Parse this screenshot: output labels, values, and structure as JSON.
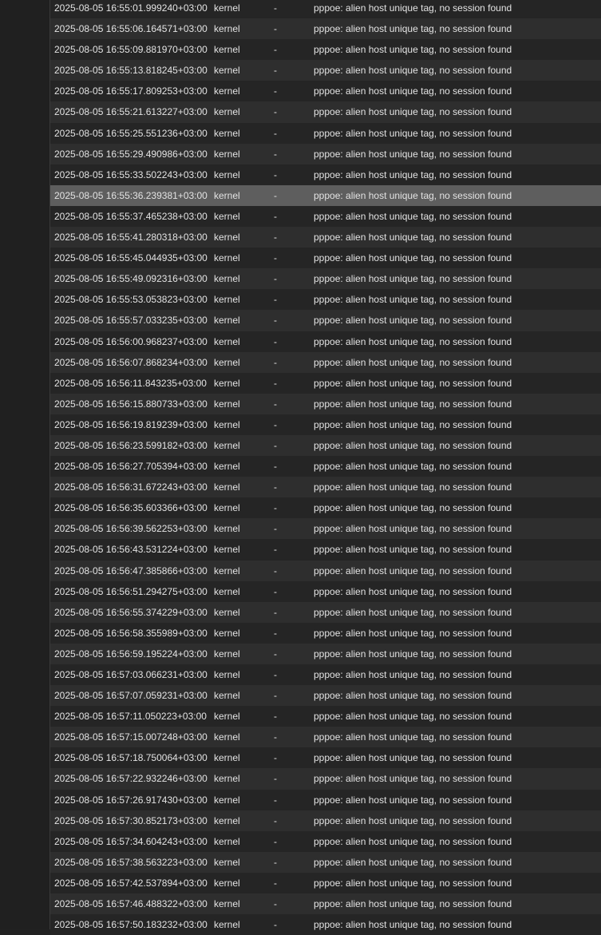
{
  "log": {
    "selected_index": 9,
    "rows": [
      {
        "time": "2025-08-05 16:55:01.999240+03:00",
        "process": "kernel",
        "pid": "-",
        "message": "pppoe: alien host unique tag, no session found"
      },
      {
        "time": "2025-08-05 16:55:06.164571+03:00",
        "process": "kernel",
        "pid": "-",
        "message": "pppoe: alien host unique tag, no session found"
      },
      {
        "time": "2025-08-05 16:55:09.881970+03:00",
        "process": "kernel",
        "pid": "-",
        "message": "pppoe: alien host unique tag, no session found"
      },
      {
        "time": "2025-08-05 16:55:13.818245+03:00",
        "process": "kernel",
        "pid": "-",
        "message": "pppoe: alien host unique tag, no session found"
      },
      {
        "time": "2025-08-05 16:55:17.809253+03:00",
        "process": "kernel",
        "pid": "-",
        "message": "pppoe: alien host unique tag, no session found"
      },
      {
        "time": "2025-08-05 16:55:21.613227+03:00",
        "process": "kernel",
        "pid": "-",
        "message": "pppoe: alien host unique tag, no session found"
      },
      {
        "time": "2025-08-05 16:55:25.551236+03:00",
        "process": "kernel",
        "pid": "-",
        "message": "pppoe: alien host unique tag, no session found"
      },
      {
        "time": "2025-08-05 16:55:29.490986+03:00",
        "process": "kernel",
        "pid": "-",
        "message": "pppoe: alien host unique tag, no session found"
      },
      {
        "time": "2025-08-05 16:55:33.502243+03:00",
        "process": "kernel",
        "pid": "-",
        "message": "pppoe: alien host unique tag, no session found"
      },
      {
        "time": "2025-08-05 16:55:36.239381+03:00",
        "process": "kernel",
        "pid": "-",
        "message": "pppoe: alien host unique tag, no session found"
      },
      {
        "time": "2025-08-05 16:55:37.465238+03:00",
        "process": "kernel",
        "pid": "-",
        "message": "pppoe: alien host unique tag, no session found"
      },
      {
        "time": "2025-08-05 16:55:41.280318+03:00",
        "process": "kernel",
        "pid": "-",
        "message": "pppoe: alien host unique tag, no session found"
      },
      {
        "time": "2025-08-05 16:55:45.044935+03:00",
        "process": "kernel",
        "pid": "-",
        "message": "pppoe: alien host unique tag, no session found"
      },
      {
        "time": "2025-08-05 16:55:49.092316+03:00",
        "process": "kernel",
        "pid": "-",
        "message": "pppoe: alien host unique tag, no session found"
      },
      {
        "time": "2025-08-05 16:55:53.053823+03:00",
        "process": "kernel",
        "pid": "-",
        "message": "pppoe: alien host unique tag, no session found"
      },
      {
        "time": "2025-08-05 16:55:57.033235+03:00",
        "process": "kernel",
        "pid": "-",
        "message": "pppoe: alien host unique tag, no session found"
      },
      {
        "time": "2025-08-05 16:56:00.968237+03:00",
        "process": "kernel",
        "pid": "-",
        "message": "pppoe: alien host unique tag, no session found"
      },
      {
        "time": "2025-08-05 16:56:07.868234+03:00",
        "process": "kernel",
        "pid": "-",
        "message": "pppoe: alien host unique tag, no session found"
      },
      {
        "time": "2025-08-05 16:56:11.843235+03:00",
        "process": "kernel",
        "pid": "-",
        "message": "pppoe: alien host unique tag, no session found"
      },
      {
        "time": "2025-08-05 16:56:15.880733+03:00",
        "process": "kernel",
        "pid": "-",
        "message": "pppoe: alien host unique tag, no session found"
      },
      {
        "time": "2025-08-05 16:56:19.819239+03:00",
        "process": "kernel",
        "pid": "-",
        "message": "pppoe: alien host unique tag, no session found"
      },
      {
        "time": "2025-08-05 16:56:23.599182+03:00",
        "process": "kernel",
        "pid": "-",
        "message": "pppoe: alien host unique tag, no session found"
      },
      {
        "time": "2025-08-05 16:56:27.705394+03:00",
        "process": "kernel",
        "pid": "-",
        "message": "pppoe: alien host unique tag, no session found"
      },
      {
        "time": "2025-08-05 16:56:31.672243+03:00",
        "process": "kernel",
        "pid": "-",
        "message": "pppoe: alien host unique tag, no session found"
      },
      {
        "time": "2025-08-05 16:56:35.603366+03:00",
        "process": "kernel",
        "pid": "-",
        "message": "pppoe: alien host unique tag, no session found"
      },
      {
        "time": "2025-08-05 16:56:39.562253+03:00",
        "process": "kernel",
        "pid": "-",
        "message": "pppoe: alien host unique tag, no session found"
      },
      {
        "time": "2025-08-05 16:56:43.531224+03:00",
        "process": "kernel",
        "pid": "-",
        "message": "pppoe: alien host unique tag, no session found"
      },
      {
        "time": "2025-08-05 16:56:47.385866+03:00",
        "process": "kernel",
        "pid": "-",
        "message": "pppoe: alien host unique tag, no session found"
      },
      {
        "time": "2025-08-05 16:56:51.294275+03:00",
        "process": "kernel",
        "pid": "-",
        "message": "pppoe: alien host unique tag, no session found"
      },
      {
        "time": "2025-08-05 16:56:55.374229+03:00",
        "process": "kernel",
        "pid": "-",
        "message": "pppoe: alien host unique tag, no session found"
      },
      {
        "time": "2025-08-05 16:56:58.355989+03:00",
        "process": "kernel",
        "pid": "-",
        "message": "pppoe: alien host unique tag, no session found"
      },
      {
        "time": "2025-08-05 16:56:59.195224+03:00",
        "process": "kernel",
        "pid": "-",
        "message": "pppoe: alien host unique tag, no session found"
      },
      {
        "time": "2025-08-05 16:57:03.066231+03:00",
        "process": "kernel",
        "pid": "-",
        "message": "pppoe: alien host unique tag, no session found"
      },
      {
        "time": "2025-08-05 16:57:07.059231+03:00",
        "process": "kernel",
        "pid": "-",
        "message": "pppoe: alien host unique tag, no session found"
      },
      {
        "time": "2025-08-05 16:57:11.050223+03:00",
        "process": "kernel",
        "pid": "-",
        "message": "pppoe: alien host unique tag, no session found"
      },
      {
        "time": "2025-08-05 16:57:15.007248+03:00",
        "process": "kernel",
        "pid": "-",
        "message": "pppoe: alien host unique tag, no session found"
      },
      {
        "time": "2025-08-05 16:57:18.750064+03:00",
        "process": "kernel",
        "pid": "-",
        "message": "pppoe: alien host unique tag, no session found"
      },
      {
        "time": "2025-08-05 16:57:22.932246+03:00",
        "process": "kernel",
        "pid": "-",
        "message": "pppoe: alien host unique tag, no session found"
      },
      {
        "time": "2025-08-05 16:57:26.917430+03:00",
        "process": "kernel",
        "pid": "-",
        "message": "pppoe: alien host unique tag, no session found"
      },
      {
        "time": "2025-08-05 16:57:30.852173+03:00",
        "process": "kernel",
        "pid": "-",
        "message": "pppoe: alien host unique tag, no session found"
      },
      {
        "time": "2025-08-05 16:57:34.604243+03:00",
        "process": "kernel",
        "pid": "-",
        "message": "pppoe: alien host unique tag, no session found"
      },
      {
        "time": "2025-08-05 16:57:38.563223+03:00",
        "process": "kernel",
        "pid": "-",
        "message": "pppoe: alien host unique tag, no session found"
      },
      {
        "time": "2025-08-05 16:57:42.537894+03:00",
        "process": "kernel",
        "pid": "-",
        "message": "pppoe: alien host unique tag, no session found"
      },
      {
        "time": "2025-08-05 16:57:46.488322+03:00",
        "process": "kernel",
        "pid": "-",
        "message": "pppoe: alien host unique tag, no session found"
      },
      {
        "time": "2025-08-05 16:57:50.183232+03:00",
        "process": "kernel",
        "pid": "-",
        "message": "pppoe: alien host unique tag, no session found"
      }
    ]
  }
}
